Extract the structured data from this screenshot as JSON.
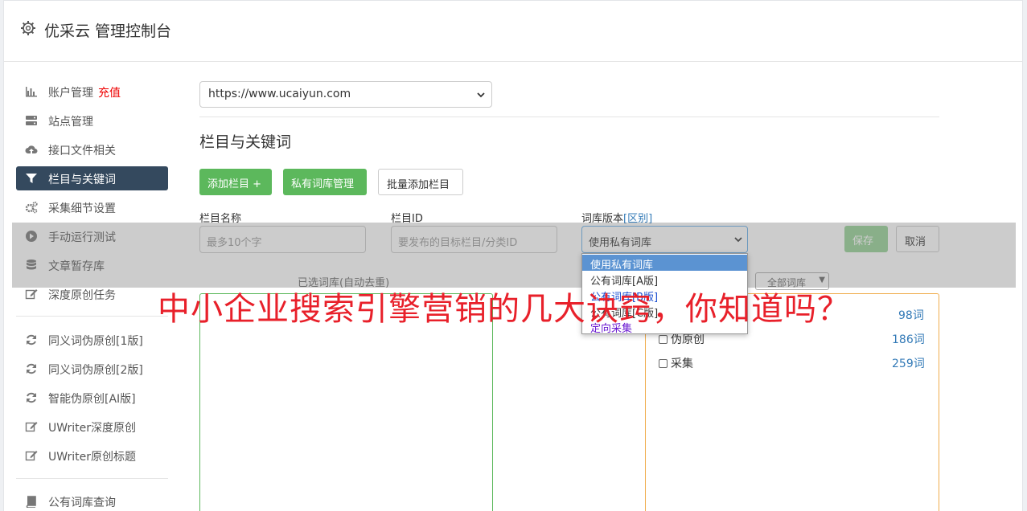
{
  "header": {
    "title": "优采云 管理控制台",
    "icon": "gear-icon"
  },
  "sidebar": {
    "items": [
      {
        "label": "账户管理",
        "extra": "充值",
        "icon": "bar-chart-icon"
      },
      {
        "label": "站点管理",
        "icon": "server-icon"
      },
      {
        "label": "接口文件相关",
        "icon": "cloud-upload-icon"
      },
      {
        "label": "栏目与关键词",
        "icon": "filter-icon",
        "active": true
      },
      {
        "label": "采集细节设置",
        "icon": "cogs-icon"
      },
      {
        "label": "手动运行测试",
        "icon": "play-circle-icon"
      },
      {
        "label": "文章暂存库",
        "icon": "database-icon"
      },
      {
        "label": "深度原创任务",
        "icon": "edit-icon"
      },
      {
        "label": "同义词伪原创[1版]",
        "icon": "refresh-icon"
      },
      {
        "label": "同义词伪原创[2版]",
        "icon": "refresh-icon"
      },
      {
        "label": "智能伪原创[AI版]",
        "icon": "refresh-icon"
      },
      {
        "label": "UWriter深度原创",
        "icon": "edit-icon"
      },
      {
        "label": "UWriter原创标题",
        "icon": "edit-icon"
      },
      {
        "label": "公有词库查询",
        "icon": "book-icon"
      }
    ]
  },
  "main": {
    "site_select": "https://www.ucaiyun.com",
    "section_title": "栏目与关键词",
    "buttons": {
      "add_column": "添加栏目 +",
      "private_lib": "私有词库管理",
      "batch_add": "批量添加栏目"
    },
    "form": {
      "name_label": "栏目名称",
      "name_placeholder": "最多10个字",
      "id_label": "栏目ID",
      "id_placeholder": "要发布的目标栏目/分类ID",
      "version_label": "词库版本",
      "version_link": "[区别]",
      "version_value": "使用私有词库",
      "save": "保存",
      "cancel": "取消"
    },
    "selected_lib_label": "已选词库(自动去重)",
    "filter_select": "全部词库",
    "dropdown_options": [
      "使用私有词库",
      "公有词库[A版]",
      "公有词库[B版]",
      "公有词库[C版]",
      "定向采集"
    ],
    "library": [
      {
        "name": "",
        "count": "98词"
      },
      {
        "name": "伪原创",
        "count": "186词"
      },
      {
        "name": "采集",
        "count": "259词"
      }
    ]
  },
  "banner": "中小企业搜索引擎营销的几大诀窍，你知道吗？",
  "colors": {
    "accent_green": "#5cb85c",
    "sidebar_active": "#34495e",
    "banner_red": "#e8202a",
    "link_blue": "#337ab7"
  }
}
